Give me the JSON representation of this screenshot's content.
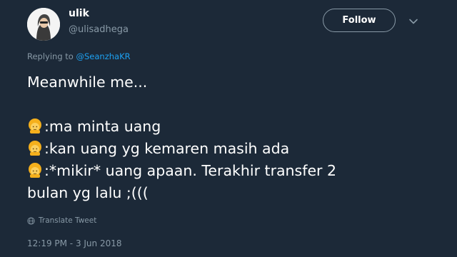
{
  "user": {
    "display_name": "ulik",
    "handle": "@ulisadhega"
  },
  "actions": {
    "follow_label": "Follow"
  },
  "reply": {
    "prefix": "Replying to ",
    "mention": "@SeanzhaKR"
  },
  "tweet": {
    "line1": "Meanwhile me...",
    "line2": ":ma minta uang",
    "line3": ":kan uang yg kemaren masih ada",
    "line4": ":*mikir* uang apaan. Terakhir transfer 2",
    "line5": "bulan yg lalu ;((("
  },
  "translate_label": "Translate Tweet",
  "timestamp": "12:19 PM - 3 Jun 2018",
  "icons": {
    "avatar": "profile-photo",
    "caret": "chevron-down-icon",
    "emoji": "girl-emoji",
    "translate": "globe-icon"
  },
  "colors": {
    "background": "#1c2938",
    "text": "#ffffff",
    "secondary": "#8899a6",
    "link": "#1da1f2",
    "emoji": "#f5b01c"
  }
}
